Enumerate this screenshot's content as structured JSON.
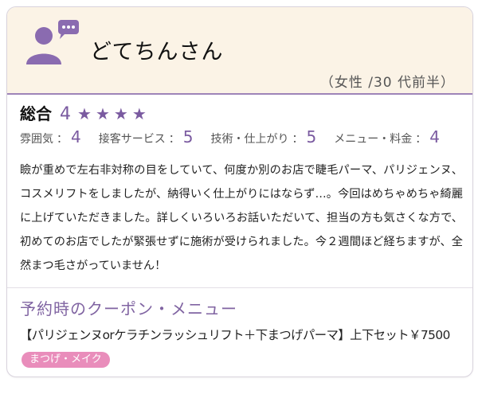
{
  "reviewer": {
    "name": "どてちんさん",
    "profile": "（女性 /30 代前半）",
    "icon": "user-comment-icon"
  },
  "rating": {
    "overall_label": "総合",
    "overall_score": "4",
    "stars": [
      "★",
      "★",
      "★",
      "★"
    ],
    "sub": [
      {
        "label": "雰囲気",
        "value": "4"
      },
      {
        "label": "接客サービス",
        "value": "5"
      },
      {
        "label": "技術・仕上がり",
        "value": "5"
      },
      {
        "label": "メニュー・料金",
        "value": "4"
      }
    ]
  },
  "comment": "瞼が重めで左右非対称の目をしていて、何度か別のお店で睫毛パーマ、パリジェンヌ、コスメリフトをしましたが、納得いく仕上がりにはならず…。今回はめちゃめちゃ綺麗に上げていただきました。詳しくいろいろお話いただいて、担当の方も気さくな方で、初めてのお店でしたが緊張せずに施術が受けられました。今２週間ほど経ちますが、全然まつ毛さがっていません！",
  "coupon": {
    "title": "予約時のクーポン・メニュー",
    "text": "【パリジェンヌorケラチンラッシュリフト＋下まつげパーマ】上下セット￥7500",
    "tag": "まつげ・メイク"
  },
  "colors": {
    "accent": "#7a5aa0",
    "header_bg": "#fbf3e6",
    "tag_bg": "#e98dbb"
  }
}
